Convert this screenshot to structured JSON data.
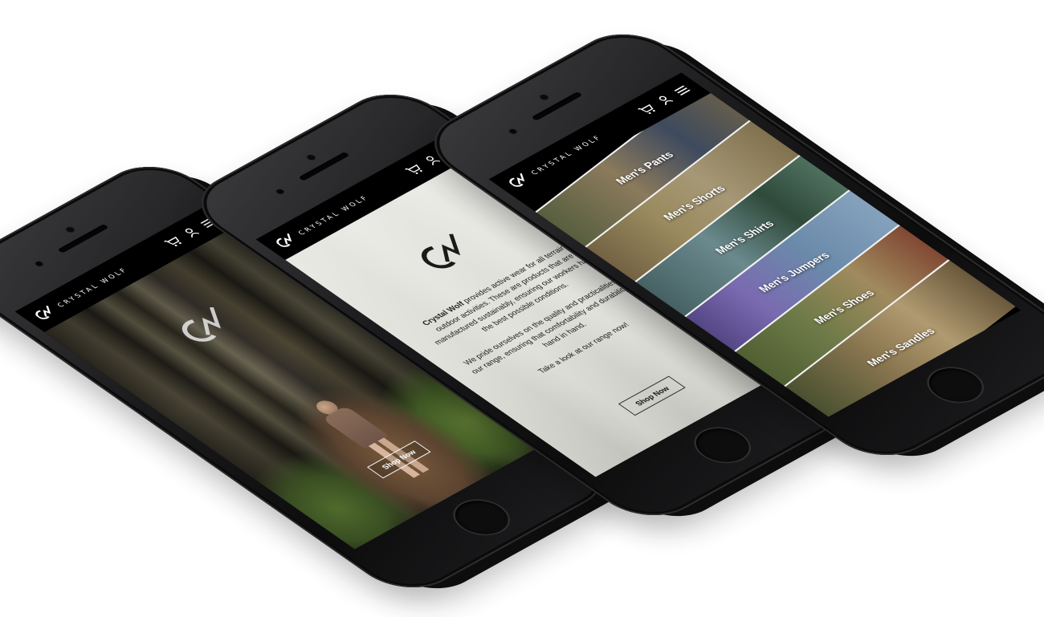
{
  "brand": {
    "name": "CRYSTAL WOLF",
    "logo_letters": "CW"
  },
  "nav": {
    "icons": [
      "cart-icon",
      "user-icon",
      "menu-icon"
    ]
  },
  "hero": {
    "shop_button": "Shop Now"
  },
  "about": {
    "brand_bold": "Crystal Wolf",
    "paragraph_1_rest": " provides active wear for all terrain outdoor activities. These are products that are manufactured sustainably, ensuring our workers have the best possible conditions.",
    "paragraph_2": "We pride ourselves on the quality and practicalities of our range, ensuring that comfortability and durability go hand in hand.",
    "paragraph_3": "Take a look at our range now!",
    "shop_button": "Shop Now"
  },
  "categories": {
    "items": [
      {
        "label": "Men's Pants"
      },
      {
        "label": "Men's Shorts"
      },
      {
        "label": "Men's Shirts"
      },
      {
        "label": "Men's Jumpers"
      },
      {
        "label": "Men's Shoes"
      },
      {
        "label": "Men's Sandles"
      }
    ]
  },
  "colors": {
    "background": "#ffffff",
    "phone_body": "#1b1b1d",
    "navbar": "#000000",
    "text_light": "#ffffff",
    "text_dark": "#1d1d1d"
  }
}
